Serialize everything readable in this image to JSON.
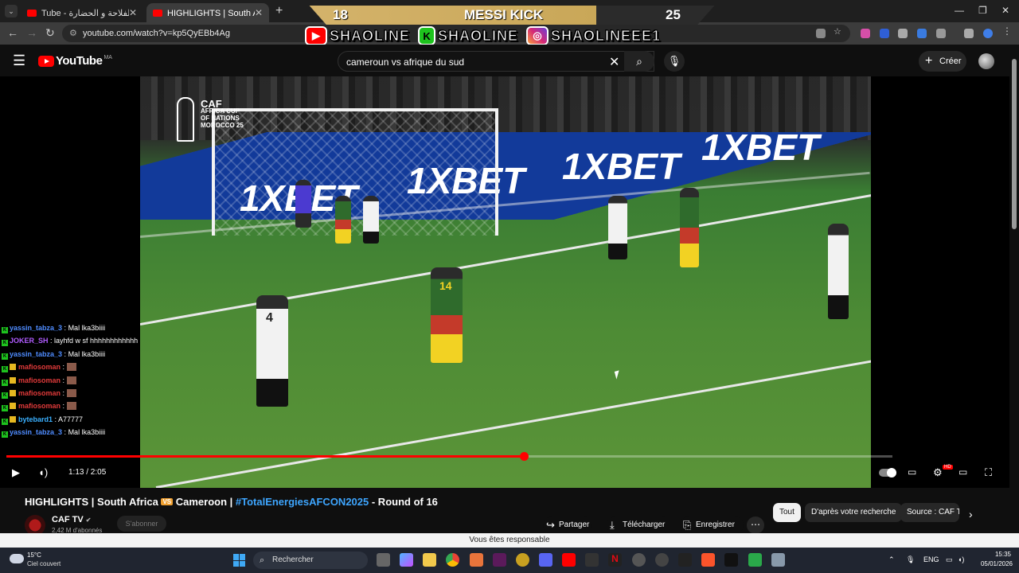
{
  "browser": {
    "tabs": [
      {
        "label": "Tube - منتخب الفلاحة و الحضارة",
        "active": false
      },
      {
        "label": "HIGHLIGHTS | South Africa 🆚 Ca",
        "active": true
      }
    ],
    "url": "youtube.com/watch?v=kp5QyEBb4Ag"
  },
  "stream_overlay": {
    "left_number": "18",
    "title": "MESSI KICK",
    "right_number": "25",
    "socials": [
      {
        "platform": "youtube-icon",
        "handle": "SHAOLINE"
      },
      {
        "platform": "kick-icon",
        "handle": "SHAOLINE"
      },
      {
        "platform": "instagram-icon",
        "handle": "SHAOLINEEE1"
      }
    ]
  },
  "youtube": {
    "logo_text": "YouTube",
    "country_code": "MA",
    "search_query": "cameroun vs afrique du sud",
    "create_label": "Créer"
  },
  "video_overlay": {
    "caf_line1": "CAF",
    "caf_line2": "AFRICA CUP",
    "caf_line3": "OF NATIONS",
    "caf_line4": "MOROCCO 25",
    "ad_text": "1XBET",
    "player_number_a": "14",
    "player_number_b": "4"
  },
  "chat": [
    {
      "user": "yassin_tabza_3",
      "color": "#4f8cff",
      "message": "Mal lka3biiii",
      "emote": false,
      "crown": false
    },
    {
      "user": "JOKER_SH",
      "color": "#b05cff",
      "message": "layhfd w sf hhhhhhhhhhhh",
      "emote": false,
      "crown": false
    },
    {
      "user": "yassin_tabza_3",
      "color": "#4f8cff",
      "message": "Mal lka3biiii",
      "emote": false,
      "crown": false
    },
    {
      "user": "mafiosoman",
      "color": "#e03a3a",
      "message": "",
      "emote": true,
      "crown": true
    },
    {
      "user": "mafiosoman",
      "color": "#e03a3a",
      "message": "",
      "emote": true,
      "crown": true
    },
    {
      "user": "mafiosoman",
      "color": "#e03a3a",
      "message": "",
      "emote": true,
      "crown": true
    },
    {
      "user": "mafiosoman",
      "color": "#e03a3a",
      "message": "",
      "emote": true,
      "crown": true
    },
    {
      "user": "bytebard1",
      "color": "#3ab0ff",
      "message": "A77777",
      "emote": false,
      "crown": true
    },
    {
      "user": "yassin_tabza_3",
      "color": "#4f8cff",
      "message": "Mal lka3biiii",
      "emote": false,
      "crown": false
    }
  ],
  "player": {
    "current_time": "1:13",
    "duration": "2:05",
    "time_display": "1:13 / 2:05",
    "progress_fraction": 0.584,
    "hd_badge": "HD"
  },
  "video_info": {
    "title_prefix": "HIGHLIGHTS | South Africa ",
    "vs_badge": "VS",
    "title_middle": " Cameroon | ",
    "hashtag": "#TotalEnergiesAFCON2025",
    "title_suffix": " - Round of 16",
    "channel_name": "CAF TV",
    "subscribers": "2,42 M d'abonnés",
    "subscribe_label": "S'abonner",
    "actions": {
      "share": "Partager",
      "download": "Télécharger",
      "save": "Enregistrer"
    },
    "chips": [
      "Tout",
      "D'après votre recherche",
      "Source : CAF TV"
    ]
  },
  "notice_bar": "Vous êtes responsable",
  "taskbar": {
    "temperature": "15°C",
    "weather": "Ciel couvert",
    "search_placeholder": "Rechercher",
    "language": "ENG",
    "time": "15:35",
    "date": "05/01/2026"
  },
  "colors": {
    "youtube_red": "#ff0000",
    "link_blue": "#3ea6ff",
    "chat_green_badge": "#1ec31e"
  }
}
